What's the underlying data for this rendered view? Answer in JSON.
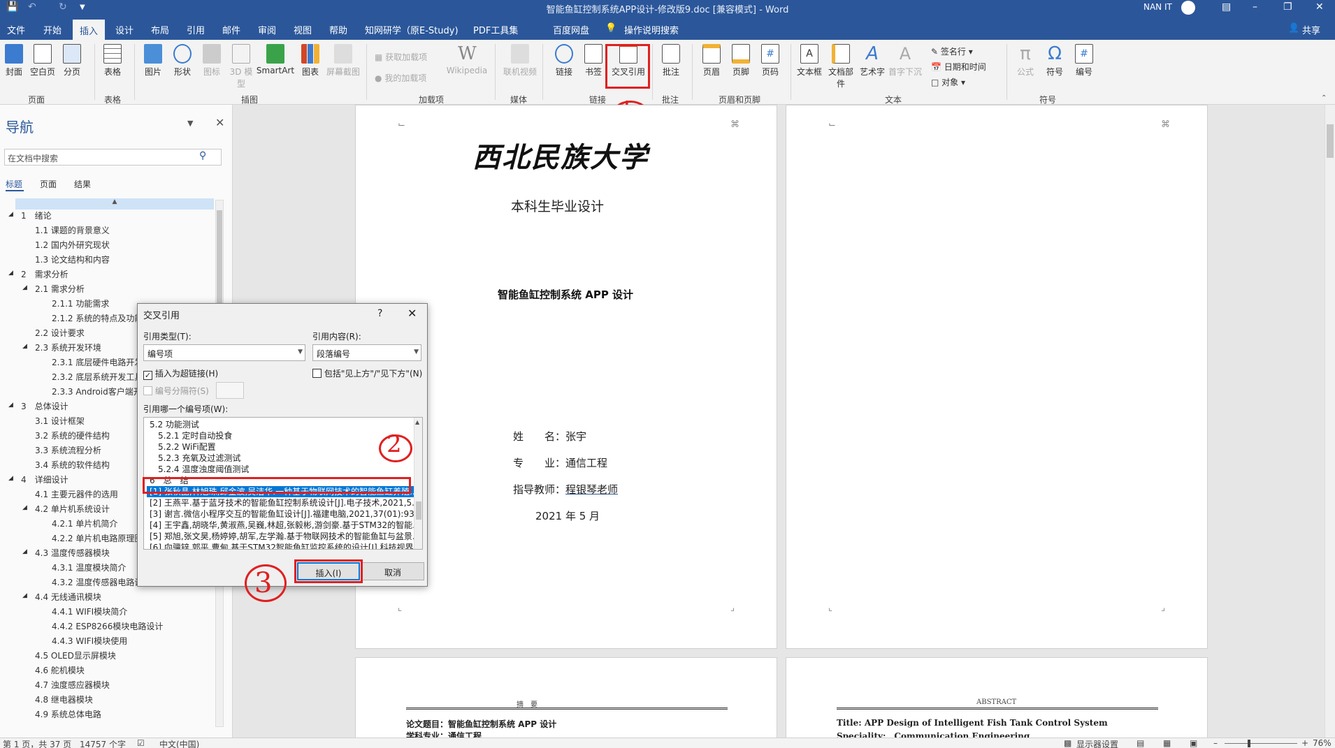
{
  "titlebar": {
    "doc_title": "智能鱼缸控制系统APP设计-修改版9.doc [兼容模式] - Word",
    "user": "NAN IT"
  },
  "menu": {
    "tabs": [
      "文件",
      "开始",
      "插入",
      "设计",
      "布局",
      "引用",
      "邮件",
      "审阅",
      "视图",
      "帮助",
      "知网研学（原E-Study)",
      "PDF工具集",
      "百度网盘"
    ],
    "tell_me": "操作说明搜索",
    "share": "共享"
  },
  "ribbon": {
    "pages": {
      "cover": "封面",
      "blank": "空白页",
      "break": "分页",
      "group": "页面"
    },
    "tables": {
      "table": "表格",
      "group": "表格"
    },
    "illustrations": {
      "picture": "图片",
      "shape": "形状",
      "icon": "图标",
      "model3d": "3D 模型",
      "smartart": "SmartArt",
      "chart": "图表",
      "screenshot": "屏幕截图",
      "group": "插图"
    },
    "addins": {
      "get": "获取加载项",
      "mine": "我的加载项",
      "wiki": "Wikipedia",
      "group": "加载项"
    },
    "media": {
      "video": "联机视频",
      "group": "媒体"
    },
    "links": {
      "link": "链接",
      "bookmark": "书签",
      "crossref": "交叉引用",
      "group": "链接"
    },
    "comments": {
      "comment": "批注",
      "group": "批注"
    },
    "headerfooter": {
      "header": "页眉",
      "footer": "页脚",
      "pagenum": "页码",
      "group": "页眉和页脚"
    },
    "text": {
      "textbox": "文本框",
      "parts": "文档部件",
      "wordart": "艺术字",
      "dropcap": "首字下沉",
      "signature": "签名行",
      "datetime": "日期和时间",
      "object": "对象",
      "group": "文本"
    },
    "symbols": {
      "equation": "公式",
      "symbol": "符号",
      "number": "编号",
      "group": "符号"
    }
  },
  "nav": {
    "title": "导航",
    "search_placeholder": "在文档中搜索",
    "tabs": [
      "标题",
      "页面",
      "结果"
    ],
    "items": [
      {
        "t": "1　绪论",
        "lvl": 1
      },
      {
        "t": "1.1 课题的背景意义",
        "lvl": 2
      },
      {
        "t": "1.2 国内外研究现状",
        "lvl": 2
      },
      {
        "t": "1.3 论文结构和内容",
        "lvl": 2
      },
      {
        "t": "2　需求分析",
        "lvl": 1
      },
      {
        "t": "2.1 需求分析",
        "lvl": 2
      },
      {
        "t": "2.1.1 功能需求",
        "lvl": 3
      },
      {
        "t": "2.1.2 系统的特点及功能",
        "lvl": 3
      },
      {
        "t": "2.2 设计要求",
        "lvl": 2
      },
      {
        "t": "2.3 系统开发环境",
        "lvl": 2
      },
      {
        "t": "2.3.1 底层硬件电路开发",
        "lvl": 3
      },
      {
        "t": "2.3.2 底层系统开发工具",
        "lvl": 3
      },
      {
        "t": "2.3.3 Android客户端开",
        "lvl": 3
      },
      {
        "t": "3　总体设计",
        "lvl": 1
      },
      {
        "t": "3.1 设计框架",
        "lvl": 2
      },
      {
        "t": "3.2 系统的硬件结构",
        "lvl": 2
      },
      {
        "t": "3.3 系统流程分析",
        "lvl": 2
      },
      {
        "t": "3.4 系统的软件结构",
        "lvl": 2
      },
      {
        "t": "4　详细设计",
        "lvl": 1
      },
      {
        "t": "4.1 主要元器件的选用",
        "lvl": 2
      },
      {
        "t": "4.2 单片机系统设计",
        "lvl": 2
      },
      {
        "t": "4.2.1 单片机简介",
        "lvl": 3
      },
      {
        "t": "4.2.2 单片机电路原理图",
        "lvl": 3
      },
      {
        "t": "4.3 温度传感器模块",
        "lvl": 2
      },
      {
        "t": "4.3.1 温度模块简介",
        "lvl": 3
      },
      {
        "t": "4.3.2 温度传感器电路设",
        "lvl": 3
      },
      {
        "t": "4.4 无线通讯模块",
        "lvl": 2
      },
      {
        "t": "4.4.1 WIFI模块简介",
        "lvl": 3
      },
      {
        "t": "4.4.2 ESP8266模块电路设计",
        "lvl": 3
      },
      {
        "t": "4.4.3 WIFI模块使用",
        "lvl": 3
      },
      {
        "t": "4.5 OLED显示屏模块",
        "lvl": 2
      },
      {
        "t": "4.6 舵机模块",
        "lvl": 2
      },
      {
        "t": "4.7 浊度感应器模块",
        "lvl": 2
      },
      {
        "t": "4.8 继电器模块",
        "lvl": 2
      },
      {
        "t": "4.9 系统总体电路",
        "lvl": 2
      }
    ]
  },
  "doc": {
    "univ": "西北民族大学",
    "subtitle": "本科生毕业设计",
    "thesis_title": "智能鱼缸控制系统 APP 设计",
    "name_label": "姓　　名：",
    "name": "张宇",
    "major_label": "专　　业：",
    "major": "通信工程",
    "advisor_label": "指导教师：",
    "advisor": "程银琴老师",
    "date": "2021 年 5 月",
    "abstract_cn_head": "摘　要",
    "abstract_cn_line": "论文题目：智能鱼缸控制系统 APP 设计",
    "abstract_cn_line2": "学科专业：通信工程",
    "abstract_en_head": "ABSTRACT",
    "abstract_en_line": "Title: APP Design of Intelligent Fish Tank Control System",
    "abstract_en_line2": "Speciality:　Communication Engineering"
  },
  "dialog": {
    "title": "交叉引用",
    "help": "?",
    "ref_type_label": "引用类型(T):",
    "ref_type_value": "编号项",
    "ref_content_label": "引用内容(R):",
    "ref_content_value": "段落编号",
    "hyperlink_label": "插入为超链接(H)",
    "hyperlink_checked": true,
    "above_below_label": "包括\"见上方\"/\"见下方\"(N)",
    "above_below_checked": false,
    "separator_label": "编号分隔符(S)",
    "which_label": "引用哪一个编号项(W):",
    "items": [
      "5.2 功能测试",
      "　5.2.1 定时自动投食",
      "　5.2.2 WiFi配置",
      "　5.2.3 充氧及过滤测试",
      "　5.2.4 温度浊度阈值测试",
      "6　总　结",
      "[1] 张秋晶,林旭珠,邱金波,吴洁华.一种基于物联网技术的智能鱼缸养殖...",
      "[2] 王燕平.基于蓝牙技术的智能鱼缸控制系统设计[J].电子技术,2021,5...",
      "[3] 谢言.微信小程序交互的智能鱼缸设计[J].福建电脑,2021,37(01):93-...",
      "[4] 王宇鑫,胡晓华,黄淑燕,吴巍,林超,张毅彬,游剑豪.基于STM32的智能...",
      "[5] 郑旭,张文昊,杨婷婷,胡军,左学瀚.基于物联网技术的智能鱼缸与盆景...",
      "[6] 向骥锌,郭平,曹甸.基于STM32智能鱼缸监控系统的设计[J].科技视界,..."
    ],
    "selected_index": 6,
    "insert": "插入(I)",
    "cancel": "取消"
  },
  "annotations": {
    "a1": "1",
    "a2": "2",
    "a3": "3"
  },
  "status": {
    "page": "第 1 页，共 37 页",
    "words": "14757 个字",
    "lang": "中文(中国)",
    "display": "显示器设置",
    "zoom": "76%"
  },
  "colors": {
    "word_blue": "#2b579a",
    "highlight": "#e02020",
    "select": "#0078d7"
  }
}
